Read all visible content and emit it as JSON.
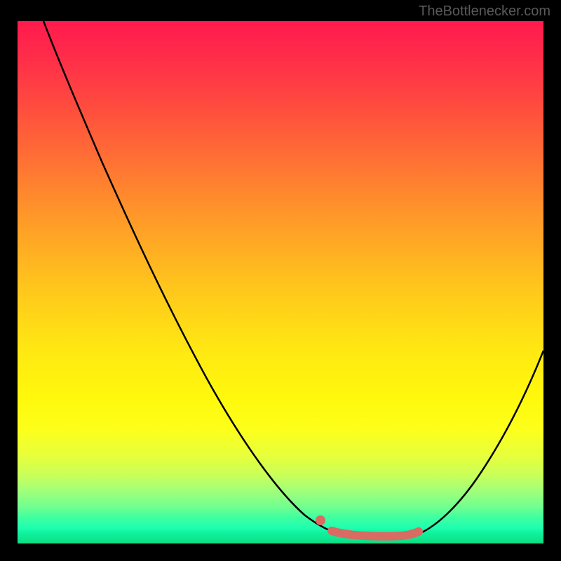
{
  "attribution": "TheBottlenecker.com",
  "chart_data": {
    "type": "line",
    "title": "",
    "xlabel": "",
    "ylabel": "",
    "xlim": [
      0,
      100
    ],
    "ylim": [
      0,
      100
    ],
    "series": [
      {
        "name": "bottleneck-curve",
        "x": [
          5,
          10,
          15,
          20,
          25,
          30,
          35,
          40,
          45,
          50,
          55,
          58,
          62,
          66,
          70,
          73,
          76,
          80,
          84,
          88,
          92,
          96,
          100
        ],
        "y": [
          100,
          93,
          85,
          77,
          68,
          60,
          51,
          43,
          34,
          26,
          17,
          11,
          6,
          3,
          1,
          0,
          0,
          2,
          7,
          14,
          23,
          33,
          44
        ]
      }
    ],
    "highlight": {
      "name": "optimal-range",
      "x_start": 58,
      "x_end": 76,
      "y": 0
    },
    "background": {
      "type": "vertical-gradient",
      "stops": [
        {
          "pos": 0,
          "color": "#ff1a4d"
        },
        {
          "pos": 50,
          "color": "#ffd21a"
        },
        {
          "pos": 100,
          "color": "#0cde82"
        }
      ]
    }
  }
}
